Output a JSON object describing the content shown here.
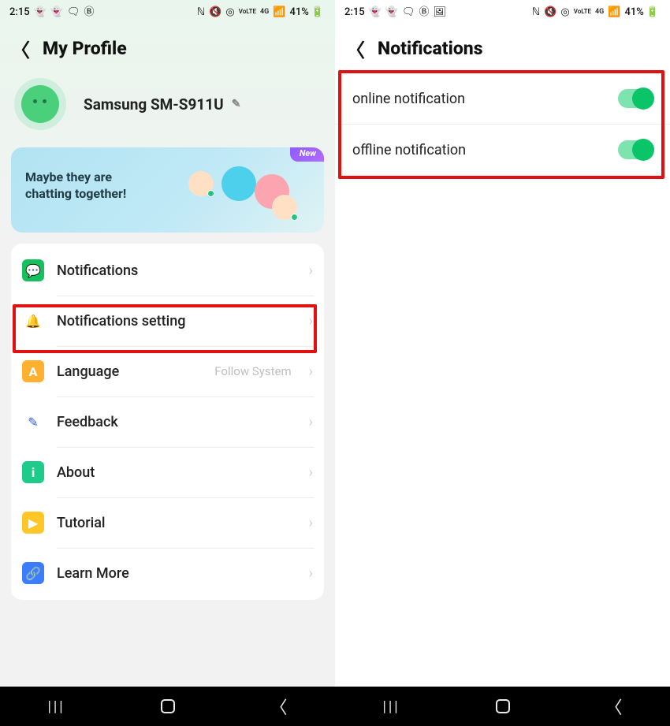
{
  "status": {
    "time": "2:15",
    "battery": "41%",
    "lte": "VoLTE",
    "net": "4G"
  },
  "left": {
    "title": "My Profile",
    "device": "Samsung SM-S911U",
    "banner_line1": "Maybe they are",
    "banner_line2": "chatting together!",
    "banner_badge": "New",
    "items": [
      {
        "label": "Notifications",
        "hint": ""
      },
      {
        "label": "Notifications setting",
        "hint": ""
      },
      {
        "label": "Language",
        "hint": "Follow System"
      },
      {
        "label": "Feedback",
        "hint": ""
      },
      {
        "label": "About",
        "hint": ""
      },
      {
        "label": "Tutorial",
        "hint": ""
      },
      {
        "label": "Learn More",
        "hint": ""
      }
    ]
  },
  "right": {
    "title": "Notifications",
    "toggles": [
      {
        "label": "online notification",
        "on": true
      },
      {
        "label": "offline notification",
        "on": true
      }
    ]
  }
}
